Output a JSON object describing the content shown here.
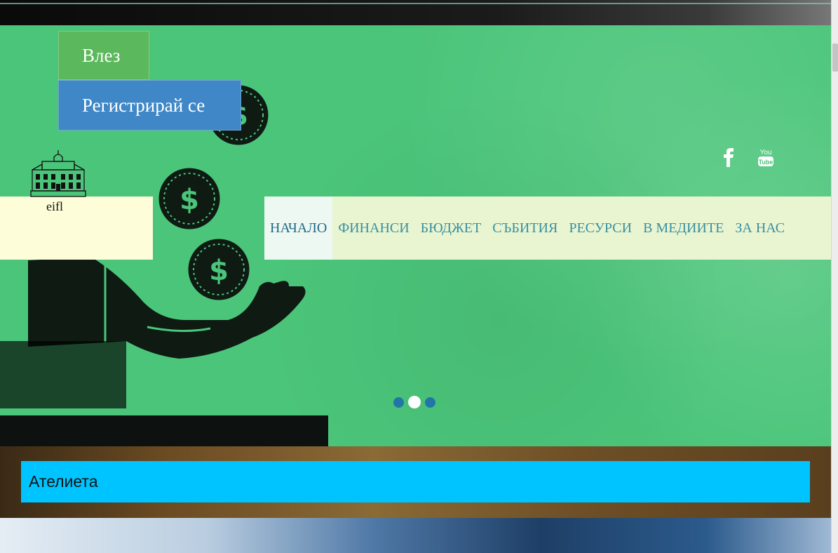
{
  "auth": {
    "login_label": "Влез",
    "register_label": "Регистрирай се"
  },
  "logo": {
    "text": "eifl",
    "icon": "building-icon"
  },
  "social": {
    "facebook_icon": "facebook-icon",
    "youtube_icon": "youtube-icon",
    "youtube_text": "You Tube"
  },
  "nav": {
    "items": [
      {
        "label": "НАЧАЛО",
        "active": true
      },
      {
        "label": "ФИНАНСИ"
      },
      {
        "label": "БЮДЖЕТ"
      },
      {
        "label": "СЪБИТИЯ"
      },
      {
        "label": "РЕСУРСИ"
      },
      {
        "label": "В МЕДИИТЕ"
      },
      {
        "label": "ЗА НАС"
      }
    ]
  },
  "slider": {
    "slide_count": 3,
    "active_index": 1
  },
  "section": {
    "title": "Ателиета"
  },
  "colors": {
    "hero_green": "#4bc57a",
    "login_green": "#5cb85c",
    "register_blue": "#3f87c7",
    "section_cyan": "#00c4ff",
    "nav_bg": "#e9f5d0",
    "nav_text": "#3b8fa0"
  }
}
